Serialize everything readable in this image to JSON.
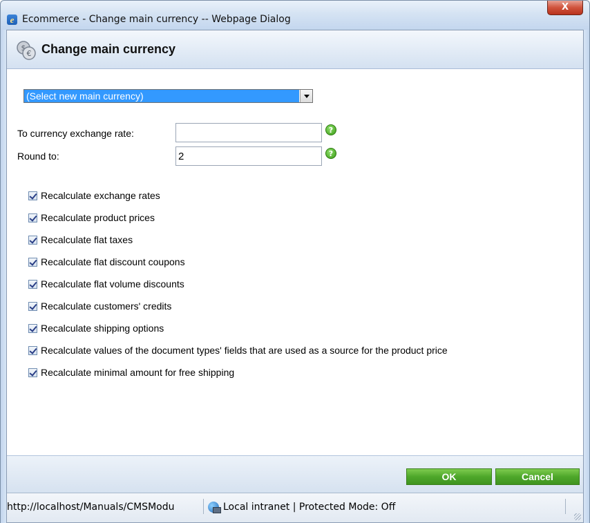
{
  "window": {
    "title": "Ecommerce - Change main currency -- Webpage Dialog",
    "close_glyph": "X"
  },
  "header": {
    "title": "Change main currency",
    "icon": "coins-icon"
  },
  "form": {
    "currency_select": {
      "selected": "(Select new main currency)"
    },
    "exchange_rate": {
      "label": "To currency exchange rate:",
      "value": ""
    },
    "round_to": {
      "label": "Round to:",
      "value": "2"
    },
    "help_glyph": "?"
  },
  "checkboxes": [
    {
      "label": "Recalculate exchange rates",
      "checked": true
    },
    {
      "label": "Recalculate product prices",
      "checked": true
    },
    {
      "label": "Recalculate flat taxes",
      "checked": true
    },
    {
      "label": "Recalculate flat discount coupons",
      "checked": true
    },
    {
      "label": "Recalculate flat volume discounts",
      "checked": true
    },
    {
      "label": "Recalculate customers' credits",
      "checked": true
    },
    {
      "label": "Recalculate shipping options",
      "checked": true
    },
    {
      "label": "Recalculate values of the document types' fields that are used as a source for the product price",
      "checked": true
    },
    {
      "label": "Recalculate minimal amount for free shipping",
      "checked": true
    }
  ],
  "buttons": {
    "ok": "OK",
    "cancel": "Cancel"
  },
  "status_bar": {
    "url": "http://localhost/Manuals/CMSModu",
    "zone": "Local intranet | Protected Mode: Off"
  },
  "colors": {
    "accent_green": "#4ea72a",
    "selection_blue": "#3399ff"
  }
}
